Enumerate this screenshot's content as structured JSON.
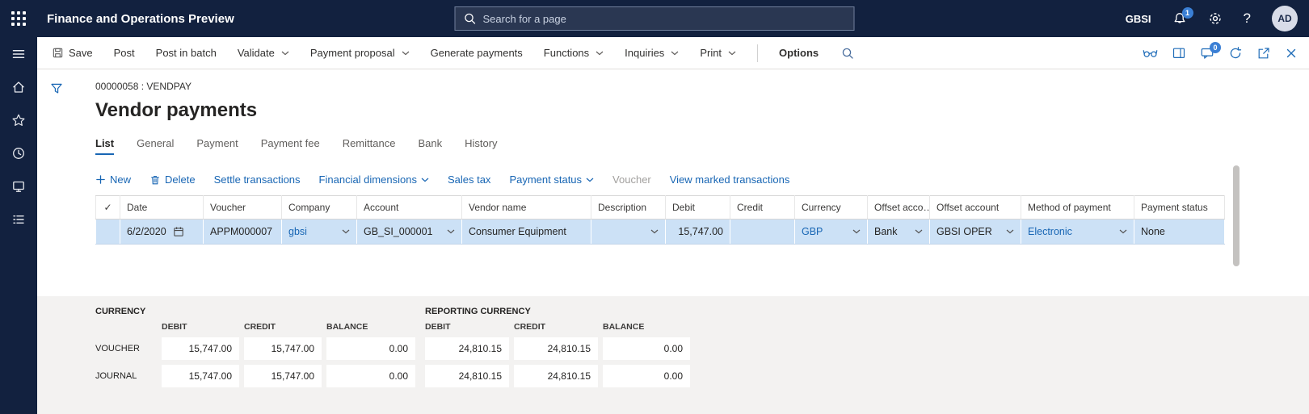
{
  "colors": {
    "topbar": "#12213f",
    "accent_blue": "#1866b4",
    "selected_row": "#cce1f6",
    "badge_blue": "#3a7fd5"
  },
  "icons": {
    "app_launcher": "waffle-grid",
    "search": "magnifier",
    "notifications": "bell",
    "settings": "gear",
    "help": "question-mark",
    "left_nav": [
      "menu",
      "home",
      "favorites-star",
      "recent-clock",
      "workspaces",
      "journal-list"
    ],
    "action_pane_right": [
      "glasses",
      "task-pane",
      "messages",
      "refresh",
      "open-new-window",
      "close"
    ]
  },
  "topbar": {
    "app_title": "Finance and Operations Preview",
    "search": {
      "placeholder": "Search for a page"
    },
    "company": "GBSI",
    "notifications": "1",
    "help": "?",
    "avatar": "AD"
  },
  "action_pane": {
    "save": "Save",
    "post": "Post",
    "post_in_batch": "Post in batch",
    "validate": "Validate",
    "payment_proposal": "Payment proposal",
    "generate_payments": "Generate payments",
    "functions": "Functions",
    "inquiries": "Inquiries",
    "print": "Print",
    "options": "Options",
    "message_badge": "0"
  },
  "page": {
    "record_id": "00000058 : VENDPAY",
    "title": "Vendor payments",
    "tabs": [
      "List",
      "General",
      "Payment",
      "Payment fee",
      "Remittance",
      "Bank",
      "History"
    ],
    "grid_actions": {
      "new": "New",
      "delete": "Delete",
      "settle": "Settle transactions",
      "findim": "Financial dimensions",
      "sales_tax": "Sales tax",
      "payment_status": "Payment status",
      "voucher": "Voucher",
      "view_marked": "View marked transactions"
    },
    "grid": {
      "select_all": "✓",
      "columns": [
        "Date",
        "Voucher",
        "Company",
        "Account",
        "Vendor name",
        "Description",
        "Debit",
        "Credit",
        "Currency",
        "Offset acco…",
        "Offset account",
        "Method of payment",
        "Payment status"
      ],
      "row": {
        "date": "6/2/2020",
        "voucher": "APPM000007",
        "company": "gbsi",
        "account": "GB_SI_000001",
        "vendor": "Consumer Equipment",
        "description": "",
        "debit": "15,747.00",
        "credit": "",
        "currency": "GBP",
        "offset_type": "Bank",
        "offset_account": "GBSI OPER",
        "method": "Electronic",
        "status": "None"
      }
    },
    "totals": {
      "currency_title": "CURRENCY",
      "reporting_title": "REPORTING CURRENCY",
      "col_debit": "DEBIT",
      "col_credit": "CREDIT",
      "col_balance": "BALANCE",
      "rows": [
        {
          "label": "VOUCHER",
          "cur": [
            "15,747.00",
            "15,747.00",
            "0.00"
          ],
          "rep": [
            "24,810.15",
            "24,810.15",
            "0.00"
          ]
        },
        {
          "label": "JOURNAL",
          "cur": [
            "15,747.00",
            "15,747.00",
            "0.00"
          ],
          "rep": [
            "24,810.15",
            "24,810.15",
            "0.00"
          ]
        }
      ]
    }
  }
}
